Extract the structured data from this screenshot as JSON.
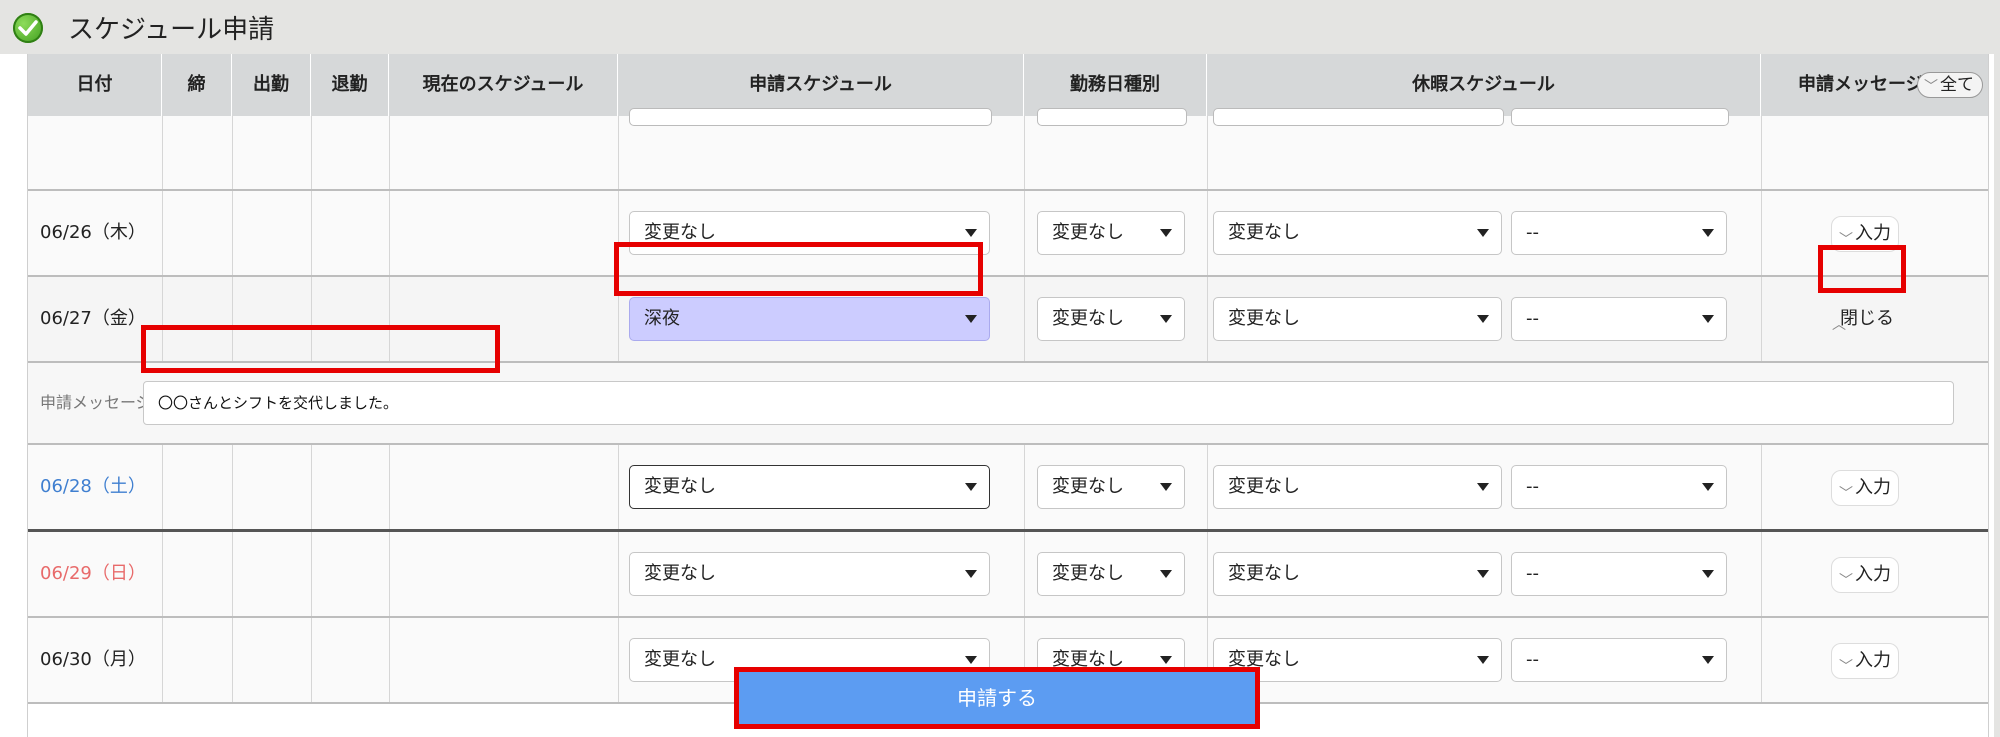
{
  "title": "スケジュール申請",
  "headers": {
    "date": "日付",
    "close": "締",
    "clock_in": "出勤",
    "clock_out": "退勤",
    "current_schedule": "現在のスケジュール",
    "request_schedule": "申請スケジュール",
    "workday_type": "勤務日種別",
    "leave_schedule": "休暇スケジュール",
    "request_message": "申請メッセージ",
    "all_button": "全て"
  },
  "rows": [
    {
      "date": "06/26（木）",
      "schedule": "変更なし",
      "workday": "変更なし",
      "leave": "変更なし",
      "leave2": "--",
      "msg_button": "入力"
    },
    {
      "date": "06/27（金）",
      "schedule": "深夜",
      "workday": "変更なし",
      "leave": "変更なし",
      "leave2": "--",
      "msg_button": "閉じる"
    },
    {
      "date": "06/28（土）",
      "schedule": "変更なし",
      "workday": "変更なし",
      "leave": "変更なし",
      "leave2": "--",
      "msg_button": "入力"
    },
    {
      "date": "06/29（日）",
      "schedule": "変更なし",
      "workday": "変更なし",
      "leave": "変更なし",
      "leave2": "--",
      "msg_button": "入力"
    },
    {
      "date": "06/30（月）",
      "schedule": "変更なし",
      "workday": "変更なし",
      "leave": "変更なし",
      "leave2": "--",
      "msg_button": "入力"
    }
  ],
  "message_row": {
    "label": "申請メッセージ",
    "value": "〇〇さんとシフトを交代しました。"
  },
  "submit_label": "申請する",
  "colors": {
    "highlight": "#e60000",
    "submit": "#5c9cf2",
    "selected_option": "#ccccff",
    "saturday": "#3f7fd0",
    "sunday": "#e86a6a"
  }
}
